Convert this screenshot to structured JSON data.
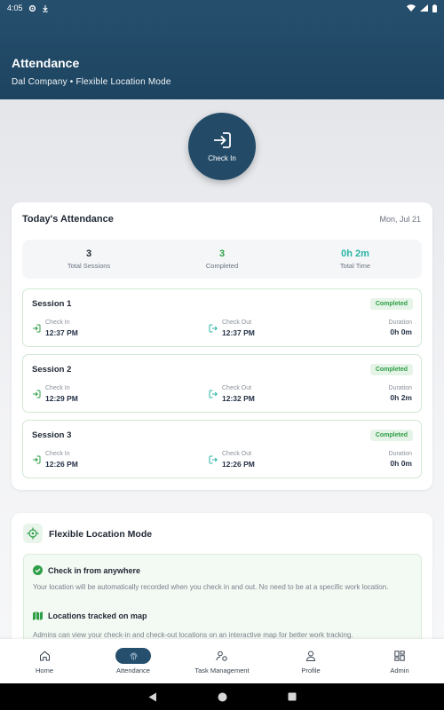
{
  "status_bar": {
    "time": "4:05"
  },
  "header": {
    "title": "Attendance",
    "subtitle": "Dal Company • Flexible Location Mode"
  },
  "check_in_button": {
    "label": "Check In"
  },
  "attendance": {
    "title": "Today's Attendance",
    "date": "Mon, Jul 21",
    "summary": [
      {
        "value": "3",
        "label": "Total Sessions",
        "color": "#1f2733"
      },
      {
        "value": "3",
        "label": "Completed",
        "color": "#2e9e47"
      },
      {
        "value": "0h 2m",
        "label": "Total Time",
        "color": "#2bb5a6"
      }
    ],
    "sessions": [
      {
        "title": "Session 1",
        "status": "Completed",
        "check_in_label": "Check In",
        "check_in": "12:37 PM",
        "check_out_label": "Check Out",
        "check_out": "12:37 PM",
        "duration_label": "Duration",
        "duration": "0h 0m"
      },
      {
        "title": "Session 2",
        "status": "Completed",
        "check_in_label": "Check In",
        "check_in": "12:29 PM",
        "check_out_label": "Check Out",
        "check_out": "12:32 PM",
        "duration_label": "Duration",
        "duration": "0h 2m"
      },
      {
        "title": "Session 3",
        "status": "Completed",
        "check_in_label": "Check In",
        "check_in": "12:26 PM",
        "check_out_label": "Check Out",
        "check_out": "12:26 PM",
        "duration_label": "Duration",
        "duration": "0h 0m"
      }
    ]
  },
  "flexible_mode": {
    "title": "Flexible Location Mode",
    "features": [
      {
        "icon": "check-circle-icon",
        "title": "Check in from anywhere",
        "desc": "Your location will be automatically recorded when you check in and out. No need to be at a specific work location."
      },
      {
        "icon": "map-icon",
        "title": "Locations tracked on map",
        "desc": "Admins can view your check-in and check-out locations on an interactive map for better work tracking."
      }
    ]
  },
  "bottom_nav": [
    {
      "label": "Home",
      "icon": "home-icon",
      "active": false
    },
    {
      "label": "Attendance",
      "icon": "fingerprint-icon",
      "active": true
    },
    {
      "label": "Task Management",
      "icon": "task-icon",
      "active": false
    },
    {
      "label": "Profile",
      "icon": "person-icon",
      "active": false
    },
    {
      "label": "Admin",
      "icon": "dashboard-icon",
      "active": false
    }
  ],
  "colors": {
    "primary": "#264f6e",
    "success": "#2e9e47",
    "teal": "#2bb5a6"
  }
}
